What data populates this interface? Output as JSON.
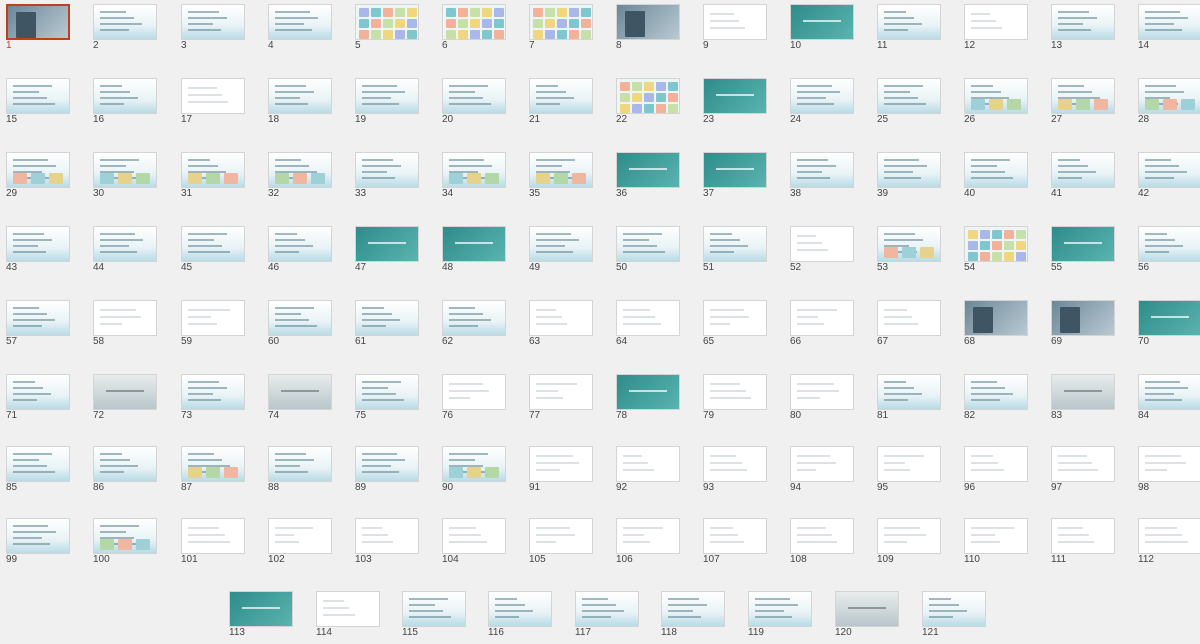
{
  "window": {
    "title": ""
  },
  "colors": {
    "selection": "#c43e1c",
    "background": "#f0f0f0"
  },
  "selected_slide": 1,
  "slide_count": 121,
  "slides": [
    {
      "n": 1,
      "kind": "photo"
    },
    {
      "n": 2,
      "kind": "text"
    },
    {
      "n": 3,
      "kind": "text"
    },
    {
      "n": 4,
      "kind": "text"
    },
    {
      "n": 5,
      "kind": "collage"
    },
    {
      "n": 6,
      "kind": "collage"
    },
    {
      "n": 7,
      "kind": "collage"
    },
    {
      "n": 8,
      "kind": "photo"
    },
    {
      "n": 9,
      "kind": "white"
    },
    {
      "n": 10,
      "kind": "teal"
    },
    {
      "n": 11,
      "kind": "text"
    },
    {
      "n": 12,
      "kind": "white"
    },
    {
      "n": 13,
      "kind": "text"
    },
    {
      "n": 14,
      "kind": "text"
    },
    {
      "n": 15,
      "kind": "text"
    },
    {
      "n": 16,
      "kind": "text"
    },
    {
      "n": 17,
      "kind": "white"
    },
    {
      "n": 18,
      "kind": "text"
    },
    {
      "n": 19,
      "kind": "text"
    },
    {
      "n": 20,
      "kind": "text"
    },
    {
      "n": 21,
      "kind": "text"
    },
    {
      "n": 22,
      "kind": "collage"
    },
    {
      "n": 23,
      "kind": "teal"
    },
    {
      "n": 24,
      "kind": "text"
    },
    {
      "n": 25,
      "kind": "text"
    },
    {
      "n": 26,
      "kind": "pics"
    },
    {
      "n": 27,
      "kind": "pics"
    },
    {
      "n": 28,
      "kind": "pics"
    },
    {
      "n": 29,
      "kind": "pics"
    },
    {
      "n": 30,
      "kind": "pics"
    },
    {
      "n": 31,
      "kind": "pics"
    },
    {
      "n": 32,
      "kind": "pics"
    },
    {
      "n": 33,
      "kind": "text"
    },
    {
      "n": 34,
      "kind": "pics"
    },
    {
      "n": 35,
      "kind": "pics"
    },
    {
      "n": 36,
      "kind": "teal"
    },
    {
      "n": 37,
      "kind": "teal"
    },
    {
      "n": 38,
      "kind": "text"
    },
    {
      "n": 39,
      "kind": "text"
    },
    {
      "n": 40,
      "kind": "text"
    },
    {
      "n": 41,
      "kind": "text"
    },
    {
      "n": 42,
      "kind": "text"
    },
    {
      "n": 43,
      "kind": "text"
    },
    {
      "n": 44,
      "kind": "text"
    },
    {
      "n": 45,
      "kind": "text"
    },
    {
      "n": 46,
      "kind": "text"
    },
    {
      "n": 47,
      "kind": "teal"
    },
    {
      "n": 48,
      "kind": "teal"
    },
    {
      "n": 49,
      "kind": "text"
    },
    {
      "n": 50,
      "kind": "text"
    },
    {
      "n": 51,
      "kind": "text"
    },
    {
      "n": 52,
      "kind": "white"
    },
    {
      "n": 53,
      "kind": "pics"
    },
    {
      "n": 54,
      "kind": "collage"
    },
    {
      "n": 55,
      "kind": "teal"
    },
    {
      "n": 56,
      "kind": "text"
    },
    {
      "n": 57,
      "kind": "text"
    },
    {
      "n": 58,
      "kind": "white"
    },
    {
      "n": 59,
      "kind": "white"
    },
    {
      "n": 60,
      "kind": "text"
    },
    {
      "n": 61,
      "kind": "text"
    },
    {
      "n": 62,
      "kind": "text"
    },
    {
      "n": 63,
      "kind": "white"
    },
    {
      "n": 64,
      "kind": "white"
    },
    {
      "n": 65,
      "kind": "white"
    },
    {
      "n": 66,
      "kind": "white"
    },
    {
      "n": 67,
      "kind": "white"
    },
    {
      "n": 68,
      "kind": "photo"
    },
    {
      "n": 69,
      "kind": "photo"
    },
    {
      "n": 70,
      "kind": "teal"
    },
    {
      "n": 71,
      "kind": "text"
    },
    {
      "n": 72,
      "kind": "gray"
    },
    {
      "n": 73,
      "kind": "text"
    },
    {
      "n": 74,
      "kind": "gray"
    },
    {
      "n": 75,
      "kind": "text"
    },
    {
      "n": 76,
      "kind": "white"
    },
    {
      "n": 77,
      "kind": "white"
    },
    {
      "n": 78,
      "kind": "teal"
    },
    {
      "n": 79,
      "kind": "white"
    },
    {
      "n": 80,
      "kind": "white"
    },
    {
      "n": 81,
      "kind": "text"
    },
    {
      "n": 82,
      "kind": "text"
    },
    {
      "n": 83,
      "kind": "gray"
    },
    {
      "n": 84,
      "kind": "text"
    },
    {
      "n": 85,
      "kind": "text"
    },
    {
      "n": 86,
      "kind": "text"
    },
    {
      "n": 87,
      "kind": "pics"
    },
    {
      "n": 88,
      "kind": "text"
    },
    {
      "n": 89,
      "kind": "text"
    },
    {
      "n": 90,
      "kind": "pics"
    },
    {
      "n": 91,
      "kind": "white"
    },
    {
      "n": 92,
      "kind": "white"
    },
    {
      "n": 93,
      "kind": "white"
    },
    {
      "n": 94,
      "kind": "white"
    },
    {
      "n": 95,
      "kind": "white"
    },
    {
      "n": 96,
      "kind": "white"
    },
    {
      "n": 97,
      "kind": "white"
    },
    {
      "n": 98,
      "kind": "white"
    },
    {
      "n": 99,
      "kind": "text"
    },
    {
      "n": 100,
      "kind": "pics"
    },
    {
      "n": 101,
      "kind": "white"
    },
    {
      "n": 102,
      "kind": "white"
    },
    {
      "n": 103,
      "kind": "white"
    },
    {
      "n": 104,
      "kind": "white"
    },
    {
      "n": 105,
      "kind": "white"
    },
    {
      "n": 106,
      "kind": "white"
    },
    {
      "n": 107,
      "kind": "white"
    },
    {
      "n": 108,
      "kind": "white"
    },
    {
      "n": 109,
      "kind": "white"
    },
    {
      "n": 110,
      "kind": "white"
    },
    {
      "n": 111,
      "kind": "white"
    },
    {
      "n": 112,
      "kind": "white"
    },
    {
      "n": 113,
      "kind": "teal"
    },
    {
      "n": 114,
      "kind": "white"
    },
    {
      "n": 115,
      "kind": "text"
    },
    {
      "n": 116,
      "kind": "text"
    },
    {
      "n": 117,
      "kind": "text"
    },
    {
      "n": 118,
      "kind": "text"
    },
    {
      "n": 119,
      "kind": "text"
    },
    {
      "n": 120,
      "kind": "gray"
    },
    {
      "n": 121,
      "kind": "text"
    }
  ]
}
